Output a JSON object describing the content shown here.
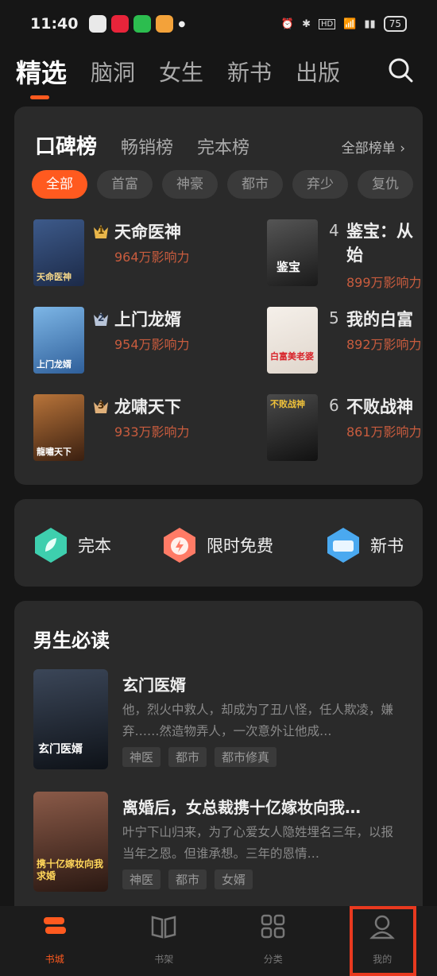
{
  "status": {
    "time": "11:40",
    "battery": "75",
    "hd": "HD"
  },
  "top_tabs": [
    {
      "label": "精选",
      "active": true
    },
    {
      "label": "脑洞",
      "active": false
    },
    {
      "label": "女生",
      "active": false
    },
    {
      "label": "新书",
      "active": false
    },
    {
      "label": "出版",
      "active": false
    }
  ],
  "ranking": {
    "tabs": [
      "口碑榜",
      "畅销榜",
      "完本榜"
    ],
    "all_link": "全部榜单 ›",
    "chips": [
      "全部",
      "首富",
      "神豪",
      "都市",
      "弃少",
      "复仇"
    ],
    "items": [
      {
        "rank": "1",
        "title": "天命医神",
        "influence": "964万影响力",
        "cover_text": "天命医神"
      },
      {
        "rank": "2",
        "title": "上门龙婿",
        "influence": "954万影响力",
        "cover_text": "上门龙婿"
      },
      {
        "rank": "3",
        "title": "龙啸天下",
        "influence": "933万影响力",
        "cover_text": "龍嘯天下"
      },
      {
        "rank": "4",
        "title": "鉴宝：从始",
        "influence": "899万影响力",
        "cover_text": "鉴宝"
      },
      {
        "rank": "5",
        "title": "我的白富",
        "influence": "892万影响力",
        "cover_text": "白富美老婆"
      },
      {
        "rank": "6",
        "title": "不败战神",
        "influence": "861万影响力",
        "cover_text": "不败战神"
      }
    ]
  },
  "quick": [
    {
      "label": "完本",
      "icon": "book-leaf-icon",
      "color": "#3ecfae"
    },
    {
      "label": "限时免费",
      "icon": "timer-bolt-icon",
      "color": "#ff7b66"
    },
    {
      "label": "新书",
      "icon": "new-badge-icon",
      "color": "#4aa9f0"
    }
  ],
  "must_read": {
    "title": "男生必读",
    "books": [
      {
        "title": "玄门医婿",
        "desc": "他，烈火中救人，却成为了丑八怪，任人欺凌，嫌弃……然造物弄人，一次意外让他成…",
        "tags": [
          "神医",
          "都市",
          "都市修真"
        ],
        "cover_text": "玄门医婿"
      },
      {
        "title": "离婚后，女总裁携十亿嫁妆向我…",
        "desc": "叶宁下山归来，为了心爱女人隐姓埋名三年，以报当年之恩。但谁承想。三年的恩情…",
        "tags": [
          "神医",
          "都市",
          "女婿"
        ],
        "cover_text": "携十亿嫁妆向我求婚"
      }
    ]
  },
  "bottom_nav": [
    {
      "label": "书城",
      "active": true
    },
    {
      "label": "书架",
      "active": false
    },
    {
      "label": "分类",
      "active": false
    },
    {
      "label": "我的",
      "active": false
    }
  ],
  "colors": {
    "accent": "#ff5a1f",
    "influence": "#c95c3e",
    "highlight": "#e8391f"
  }
}
